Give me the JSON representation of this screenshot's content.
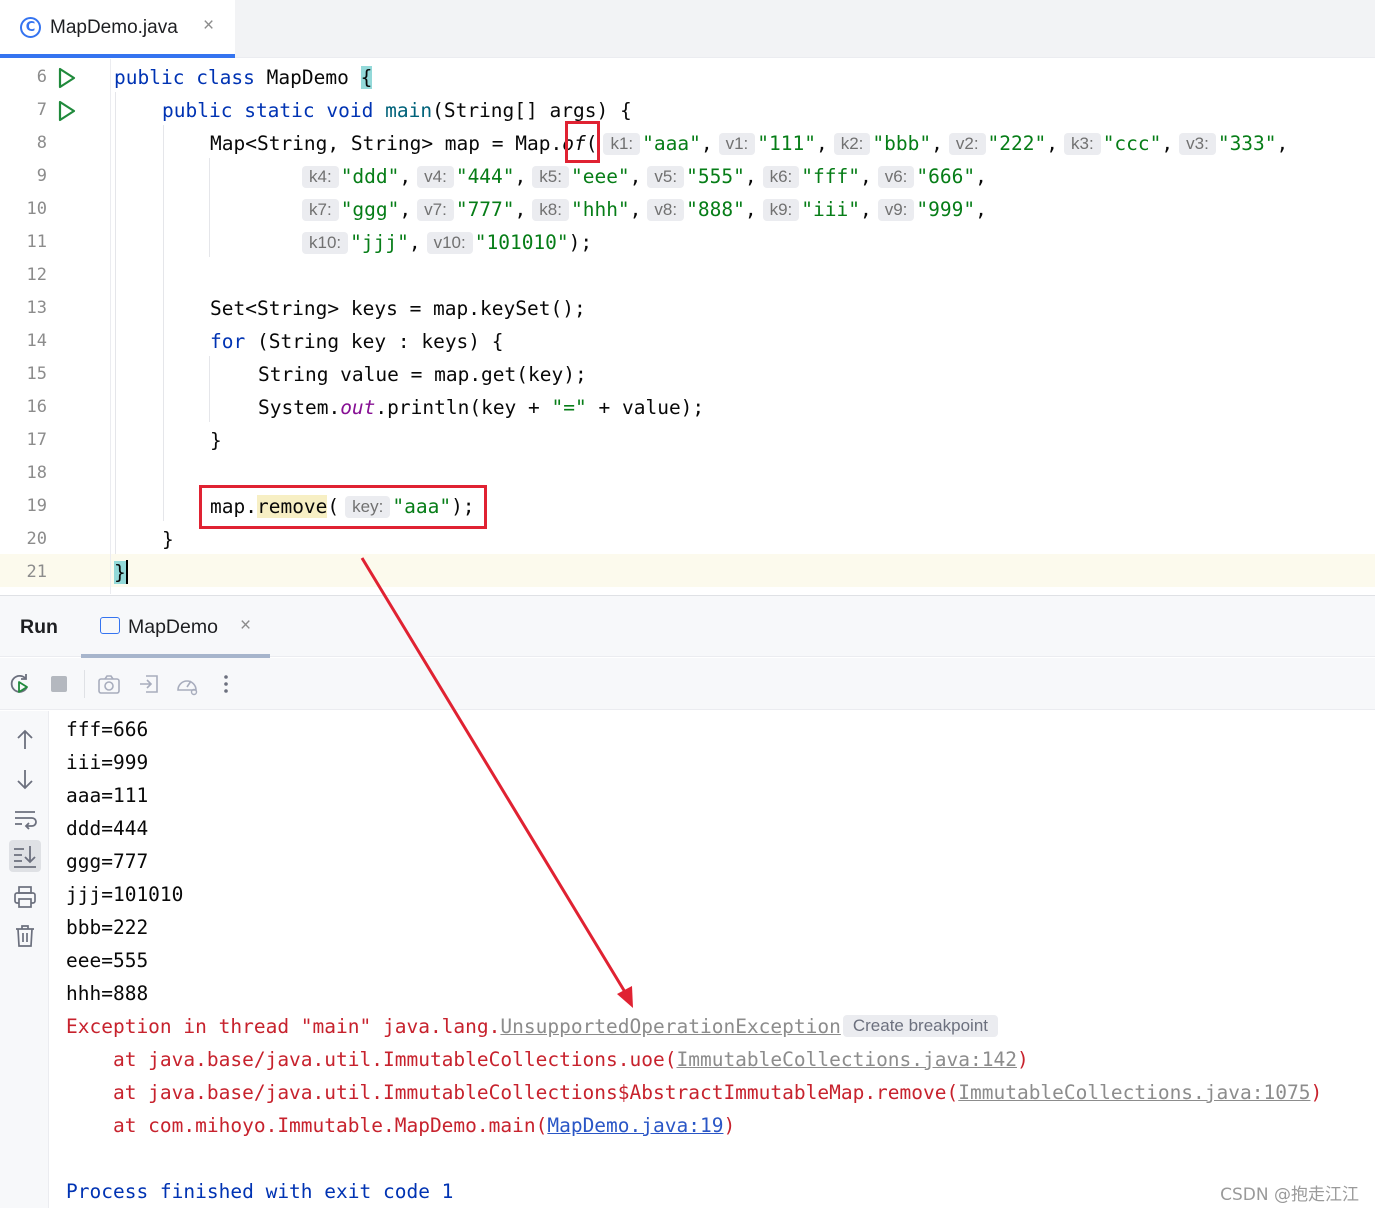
{
  "editor": {
    "tab": {
      "icon": "java-class-icon",
      "icon_glyph": "C",
      "title": "MapDemo.java",
      "close": "×"
    },
    "line_numbers": [
      "6",
      "7",
      "8",
      "9",
      "10",
      "11",
      "12",
      "13",
      "14",
      "15",
      "16",
      "17",
      "18",
      "19",
      "20",
      "21"
    ],
    "lines": {
      "l6": {
        "kw1": "public",
        "kw2": "class",
        "name": "MapDemo",
        "brace": "{"
      },
      "l7": {
        "kw1": "public",
        "kw2": "static",
        "kw3": "void",
        "method": "main",
        "rest_a": "(String[] ",
        "args": "args",
        "rest_b": ") {"
      },
      "l8": {
        "prefix": "Map<String, String> map = Map.",
        "of": "of",
        "paren": "(",
        "items": [
          {
            "hint": "k1:",
            "value": "\"aaa\"",
            "sep": ","
          },
          {
            "hint": "v1:",
            "value": "\"111\"",
            "sep": ","
          },
          {
            "hint": "k2:",
            "value": "\"bbb\"",
            "sep": ","
          },
          {
            "hint": "v2:",
            "value": "\"222\"",
            "sep": ","
          },
          {
            "hint": "k3:",
            "value": "\"ccc\"",
            "sep": ","
          },
          {
            "hint": "v3:",
            "value": "\"333\"",
            "sep": ","
          }
        ]
      },
      "l9": {
        "items": [
          {
            "hint": "k4:",
            "value": "\"ddd\"",
            "sep": ","
          },
          {
            "hint": "v4:",
            "value": "\"444\"",
            "sep": ","
          },
          {
            "hint": "k5:",
            "value": "\"eee\"",
            "sep": ","
          },
          {
            "hint": "v5:",
            "value": "\"555\"",
            "sep": ","
          },
          {
            "hint": "k6:",
            "value": "\"fff\"",
            "sep": ","
          },
          {
            "hint": "v6:",
            "value": "\"666\"",
            "sep": ","
          }
        ]
      },
      "l10": {
        "items": [
          {
            "hint": "k7:",
            "value": "\"ggg\"",
            "sep": ","
          },
          {
            "hint": "v7:",
            "value": "\"777\"",
            "sep": ","
          },
          {
            "hint": "k8:",
            "value": "\"hhh\"",
            "sep": ","
          },
          {
            "hint": "v8:",
            "value": "\"888\"",
            "sep": ","
          },
          {
            "hint": "k9:",
            "value": "\"iii\"",
            "sep": ","
          },
          {
            "hint": "v9:",
            "value": "\"999\"",
            "sep": ","
          }
        ]
      },
      "l11": {
        "items": [
          {
            "hint": "k10:",
            "value": "\"jjj\"",
            "sep": ","
          },
          {
            "hint": "v10:",
            "value": "\"101010\"",
            "sep": ");"
          }
        ]
      },
      "l13": {
        "text": "Set<String> keys = map.keySet();"
      },
      "l14": {
        "kw": "for",
        "rest": " (String key : keys) {"
      },
      "l15": {
        "text": "String value = map.get(key);"
      },
      "l16": {
        "a": "System.",
        "out": "out",
        "b": ".println(key + ",
        "str": "\"=\"",
        "c": " + value);"
      },
      "l17": {
        "text": "}"
      },
      "l19": {
        "a": "map.",
        "method": "remove",
        "b": "(",
        "hint": "key:",
        "str": "\"aaa\"",
        "c": ");"
      },
      "l20": {
        "text": "}"
      },
      "l21": {
        "text": "}"
      }
    }
  },
  "run": {
    "title": "Run",
    "tab": {
      "title": "MapDemo",
      "close": "×"
    },
    "toolbar_icons": [
      "rerun-icon",
      "stop-icon",
      "camera-icon",
      "restore-layout-icon",
      "dump-threads-icon",
      "more-icon"
    ],
    "side_icons": [
      "up-arrow-icon",
      "down-arrow-icon",
      "soft-wrap-icon",
      "scroll-to-end-icon",
      "print-icon",
      "trash-icon"
    ],
    "output": [
      "fff=666",
      "iii=999",
      "aaa=111",
      "ddd=444",
      "ggg=777",
      "jjj=101010",
      "bbb=222",
      "eee=555",
      "hhh=888"
    ],
    "exception": {
      "prefix": "Exception in thread \"main\" java.lang.",
      "class": "UnsupportedOperationException",
      "breakpoint_hint": "Create breakpoint",
      "frames": [
        {
          "text": "    at java.base/java.util.ImmutableCollections.uoe(",
          "link": "ImmutableCollections.java:142",
          "end": ")"
        },
        {
          "text": "    at java.base/java.util.ImmutableCollections$AbstractImmutableMap.remove(",
          "link": "ImmutableCollections.java:1075",
          "end": ")"
        },
        {
          "text": "    at com.mihoyo.Immutable.MapDemo.main(",
          "link": "MapDemo.java:19",
          "end": ")"
        }
      ]
    },
    "exit": "Process finished with exit code 1"
  },
  "watermark": "CSDN @抱走江江",
  "colors": {
    "keyword": "#0033b3",
    "string": "#067d17",
    "error": "#c7222d",
    "annotation_red": "#e02232",
    "accent": "#3574f0"
  }
}
